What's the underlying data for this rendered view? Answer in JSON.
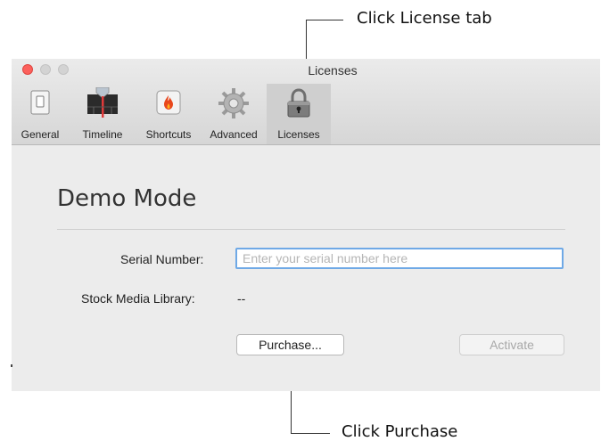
{
  "annotations": {
    "license_tab_callout": "Click License tab",
    "purchase_callout": "Click Purchase"
  },
  "window": {
    "title": "Licenses"
  },
  "toolbar": {
    "tabs": [
      {
        "label": "General",
        "icon": "switch-icon",
        "selected": false
      },
      {
        "label": "Timeline",
        "icon": "timeline-icon",
        "selected": false
      },
      {
        "label": "Shortcuts",
        "icon": "flame-key-icon",
        "selected": false
      },
      {
        "label": "Advanced",
        "icon": "gear-icon",
        "selected": false
      },
      {
        "label": "Licenses",
        "icon": "lock-icon",
        "selected": true
      }
    ]
  },
  "content": {
    "title": "Demo Mode",
    "serial_label": "Serial Number:",
    "serial_value": "",
    "serial_placeholder": "Enter your serial number here",
    "stock_label": "Stock Media Library:",
    "stock_value": "--",
    "purchase_button": "Purchase...",
    "activate_button": "Activate"
  },
  "colors": {
    "close_button": "#fc605c",
    "focus_ring": "#6fa9e6",
    "selected_tab": "#cfcfcf"
  }
}
